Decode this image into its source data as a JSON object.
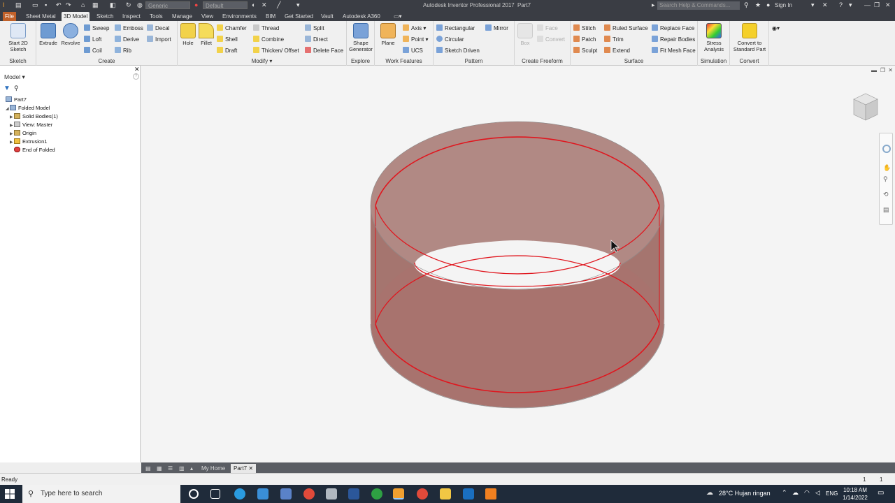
{
  "app": {
    "title": "Autodesk Inventor Professional 2017",
    "document": "Part7"
  },
  "quick_access": {
    "material": "Generic",
    "appearance": "Default"
  },
  "help": {
    "search_placeholder": "Search Help & Commands...",
    "sign_in": "Sign In"
  },
  "tabs": [
    "File",
    "Sheet Metal",
    "3D Model",
    "Sketch",
    "Inspect",
    "Tools",
    "Manage",
    "View",
    "Environments",
    "BIM",
    "Get Started",
    "Vault",
    "Autodesk A360"
  ],
  "active_tab": "3D Model",
  "ribbon": {
    "sketch": {
      "label": "Sketch",
      "start_2d_sketch": "Start 2D Sketch"
    },
    "create": {
      "label": "Create",
      "extrude": "Extrude",
      "revolve": "Revolve",
      "sweep": "Sweep",
      "emboss": "Emboss",
      "decal": "Decal",
      "loft": "Loft",
      "derive": "Derive",
      "import": "Import",
      "coil": "Coil",
      "rib": "Rib"
    },
    "modify": {
      "label": "Modify",
      "hole": "Hole",
      "fillet": "Fillet",
      "chamfer": "Chamfer",
      "thread": "Thread",
      "split": "Split",
      "shell": "Shell",
      "combine": "Combine",
      "direct": "Direct",
      "draft": "Draft",
      "thicken_offset": "Thicken/ Offset",
      "delete_face": "Delete Face"
    },
    "explore": {
      "label": "Explore",
      "shape_generator": "Shape Generator"
    },
    "work_features": {
      "label": "Work Features",
      "plane": "Plane",
      "axis": "Axis",
      "point": "Point",
      "ucs": "UCS"
    },
    "pattern": {
      "label": "Pattern",
      "rectangular": "Rectangular",
      "mirror": "Mirror",
      "circular": "Circular",
      "sketch_driven": "Sketch Driven"
    },
    "create_freeform": {
      "label": "Create Freeform",
      "box": "Box",
      "face": "Face",
      "convert": "Convert"
    },
    "surface": {
      "label": "Surface",
      "stitch": "Stitch",
      "ruled_surface": "Ruled Surface",
      "replace_face": "Replace Face",
      "patch": "Patch",
      "trim": "Trim",
      "repair_bodies": "Repair Bodies",
      "sculpt": "Sculpt",
      "extend": "Extend",
      "fit_mesh_face": "Fit Mesh Face"
    },
    "simulation": {
      "label": "Simulation",
      "stress_analysis": "Stress Analysis"
    },
    "convert": {
      "label": "Convert",
      "convert_to_standard_part": "Convert to Standard Part"
    }
  },
  "browser": {
    "title": "Model",
    "root": "Part7",
    "items": [
      "Folded Model",
      "Solid Bodies(1)",
      "View: Master",
      "Origin",
      "Extrusion1",
      "End of Folded"
    ]
  },
  "doc_tabs": {
    "home": "My Home",
    "part": "Part7"
  },
  "status": {
    "text": "Ready",
    "count1": "1",
    "count2": "1"
  },
  "taskbar": {
    "search": "Type here to search",
    "weather": "28°C  Hujan ringan",
    "lang": "ENG",
    "time": "10:18 AM",
    "date": "1/14/2022"
  },
  "colors": {
    "accent_file": "#c1612a",
    "model_fill": "#a57570",
    "model_edge": "#e0161e"
  }
}
